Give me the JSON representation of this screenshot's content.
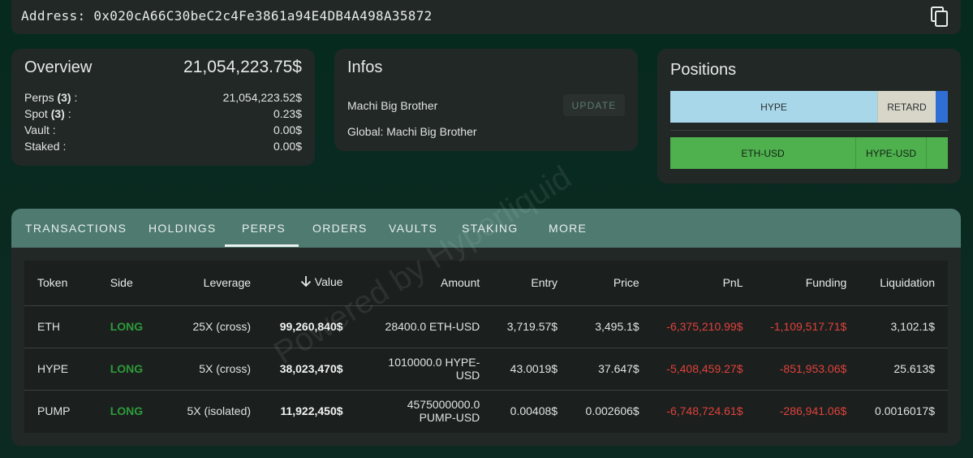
{
  "address": {
    "text": "Address: 0x020cA66C30beC2c4Fe3861a94E4DB4A498A35872"
  },
  "overview": {
    "title": "Overview",
    "total": "21,054,223.75$",
    "rows": [
      {
        "label": "Perps",
        "count": "(3)",
        "suffix": " :",
        "value": "21,054,223.52$"
      },
      {
        "label": "Spot",
        "count": "(3)",
        "suffix": " :",
        "value": "0.23$"
      },
      {
        "label": "Vault :",
        "count": "",
        "suffix": "",
        "value": "0.00$"
      },
      {
        "label": "Staked :",
        "count": "",
        "suffix": "",
        "value": "0.00$"
      }
    ]
  },
  "infos": {
    "title": "Infos",
    "name": "Machi Big Brother",
    "global": "Global: Machi Big Brother",
    "update_label": "UPDATE"
  },
  "positions": {
    "title": "Positions",
    "bar1": [
      "HYPE",
      "RETARD",
      ""
    ],
    "bar2": [
      "ETH-USD",
      "HYPE-USD",
      ""
    ],
    "colors": {
      "hype": "#a9d7ea",
      "retard": "#d8d6c9",
      "blue": "#2f6fd3",
      "green": "#4fb04e"
    }
  },
  "tabs": [
    "TRANSACTIONS",
    "HOLDINGS",
    "PERPS",
    "ORDERS",
    "VAULTS",
    "STAKING",
    "MORE"
  ],
  "active_tab": "PERPS",
  "table": {
    "headers": [
      "Token",
      "Side",
      "Leverage",
      "Value",
      "Amount",
      "Entry",
      "Price",
      "PnL",
      "Funding",
      "Liquidation"
    ],
    "rows": [
      [
        "ETH",
        "LONG",
        "25X (cross)",
        "99,260,840$",
        "28400.0 ETH-USD",
        "3,719.57$",
        "3,495.1$",
        "-6,375,210.99$",
        "-1,109,517.71$",
        "3,102.1$"
      ],
      [
        "HYPE",
        "LONG",
        "5X (cross)",
        "38,023,470$",
        "1010000.0 HYPE-USD",
        "43.0019$",
        "37.647$",
        "-5,408,459.27$",
        "-851,953.06$",
        "25.613$"
      ],
      [
        "PUMP",
        "LONG",
        "5X (isolated)",
        "11,922,450$",
        "4575000000.0 PUMP-USD",
        "0.00408$",
        "0.002606$",
        "-6,748,724.61$",
        "-286,941.06$",
        "0.0016017$"
      ]
    ]
  },
  "watermark": "Powered by Hyperliquid"
}
